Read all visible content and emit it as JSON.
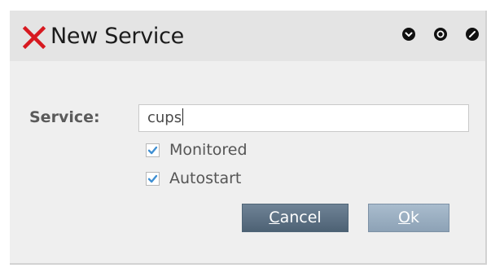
{
  "window": {
    "title": "New Service",
    "controls": [
      "minimize",
      "maximize",
      "close"
    ]
  },
  "form": {
    "service_label": "Service:",
    "service_value": "cups",
    "monitored_label": "Monitored",
    "monitored_checked": true,
    "autostart_label": "Autostart",
    "autostart_checked": true
  },
  "buttons": {
    "cancel_mnemonic": "C",
    "cancel_rest": "ancel",
    "ok_mnemonic": "O",
    "ok_rest": "k"
  },
  "colors": {
    "accent": "#d71920",
    "checkmark": "#3f8fd2",
    "button_primary": "#5c7185",
    "button_secondary": "#9aaec2"
  },
  "icons": {
    "title": "x-logo-icon",
    "checkbox": "checkmark-icon"
  }
}
